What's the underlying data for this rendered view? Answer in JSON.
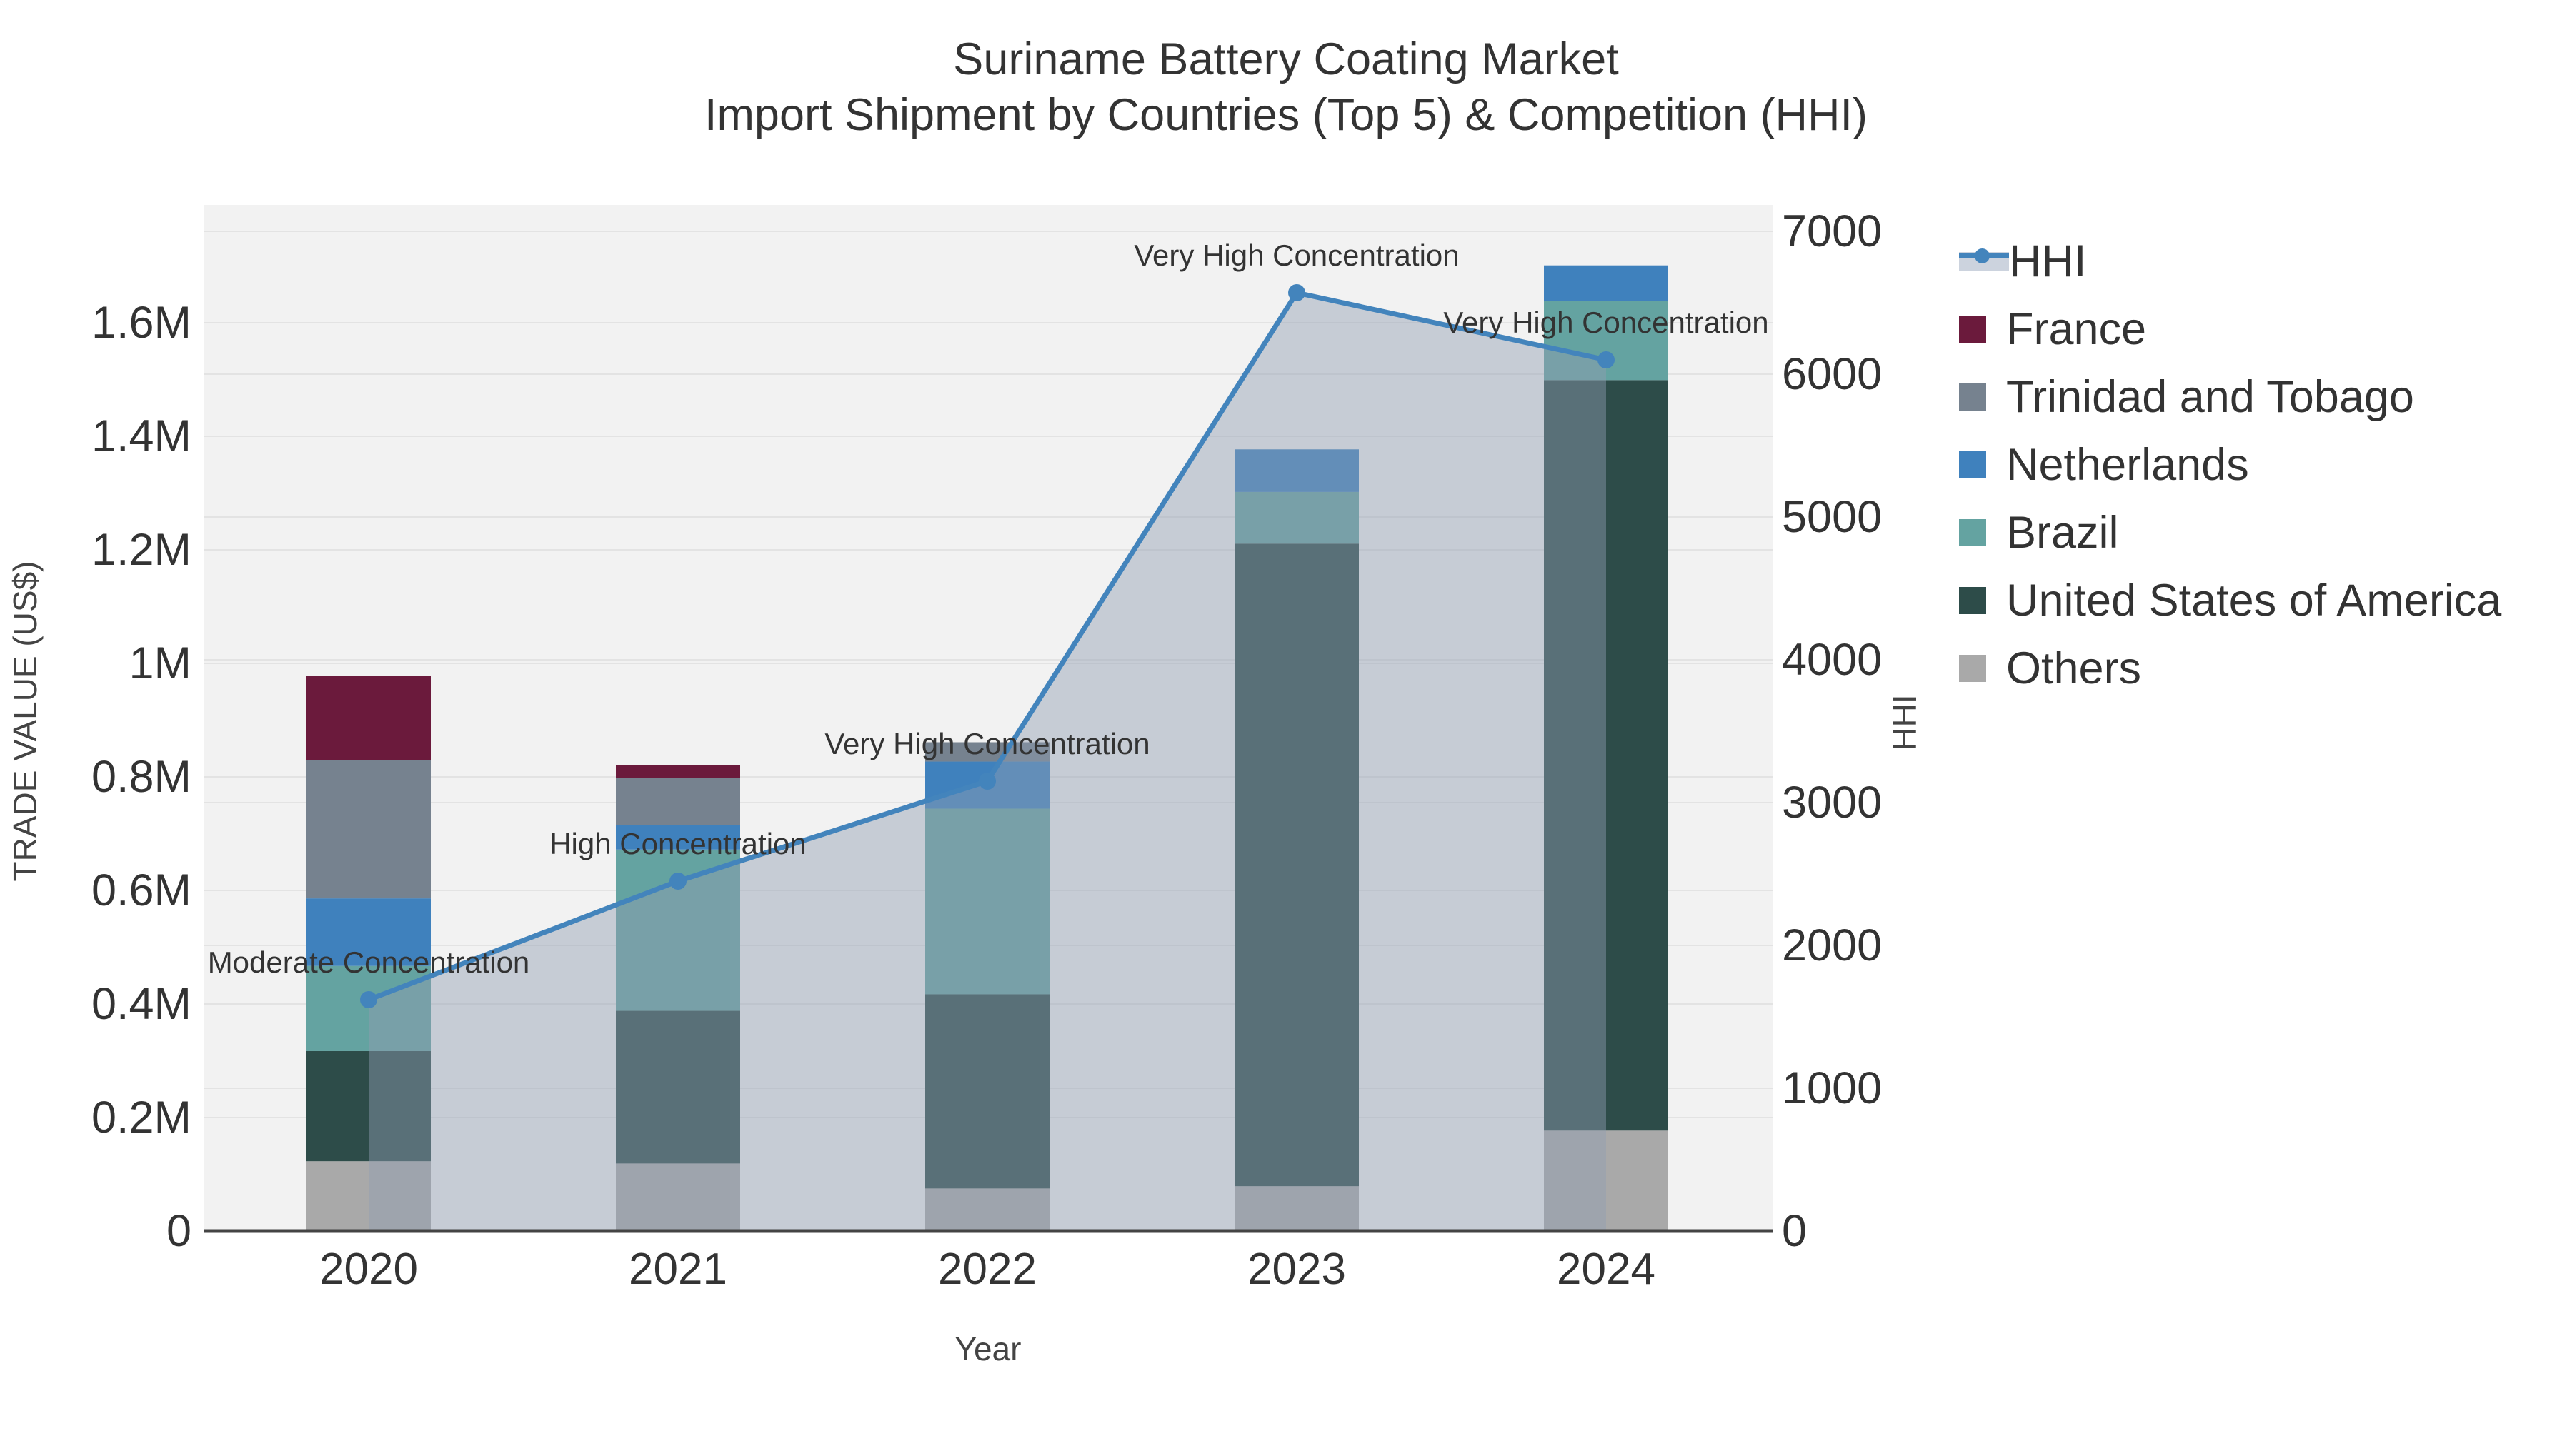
{
  "chart_data": {
    "type": "bar",
    "stacked": true,
    "title": "Suriname Battery Coating Market",
    "subtitle": "Import Shipment by Countries (Top 5) & Competition (HHI)",
    "categories": [
      "2020",
      "2021",
      "2022",
      "2023",
      "2024"
    ],
    "series": [
      {
        "name": "Others",
        "color": "#a9a9a9",
        "values": [
          123000,
          119000,
          75000,
          79000,
          177000
        ]
      },
      {
        "name": "United States of America",
        "color": "#2d4c49",
        "values": [
          194000,
          269000,
          342000,
          1132000,
          1322000
        ]
      },
      {
        "name": "Brazil",
        "color": "#64a3a1",
        "values": [
          150000,
          284000,
          327000,
          91000,
          140000
        ]
      },
      {
        "name": "Netherlands",
        "color": "#3f81bd",
        "values": [
          119000,
          43000,
          83000,
          75000,
          62000
        ]
      },
      {
        "name": "Trinidad and Tobago",
        "color": "#76828f",
        "values": [
          244000,
          83000,
          34000,
          0,
          0
        ]
      },
      {
        "name": "France",
        "color": "#6b1a3c",
        "values": [
          148000,
          23000,
          0,
          0,
          0
        ]
      }
    ],
    "line_series": {
      "name": "HHI",
      "axis": "right",
      "color": "#4384bc",
      "fill_color": "rgba(145,157,178,0.45)",
      "values": [
        1620,
        2450,
        3150,
        6570,
        6100
      ]
    },
    "annotations": [
      {
        "category": "2020",
        "text": "Moderate Concentration"
      },
      {
        "category": "2021",
        "text": "High Concentration"
      },
      {
        "category": "2022",
        "text": "Very High Concentration"
      },
      {
        "category": "2023",
        "text": "Very High Concentration"
      },
      {
        "category": "2024",
        "text": "Very High Concentration"
      }
    ],
    "x_axis": {
      "title": "Year",
      "tick_labels": [
        "2020",
        "2021",
        "2022",
        "2023",
        "2024"
      ]
    },
    "y_axis_left": {
      "title": "TRADE VALUE (US$)",
      "tick_values": [
        0,
        200000,
        400000,
        600000,
        800000,
        1000000,
        1200000,
        1400000,
        1600000
      ],
      "tick_labels": [
        "0",
        "0.2M",
        "0.4M",
        "0.6M",
        "0.8M",
        "1M",
        "1.2M",
        "1.4M",
        "1.6M"
      ],
      "range": [
        0,
        1807500
      ]
    },
    "y_axis_right": {
      "title": "HHI",
      "tick_values": [
        0,
        1000,
        2000,
        3000,
        4000,
        5000,
        6000,
        7000
      ],
      "tick_labels": [
        "0",
        "1000",
        "2000",
        "3000",
        "4000",
        "5000",
        "6000",
        "7000"
      ],
      "range": [
        0,
        7185
      ]
    },
    "legend_order": [
      "HHI",
      "France",
      "Trinidad and Tobago",
      "Netherlands",
      "Brazil",
      "United States of America",
      "Others"
    ],
    "grid": true,
    "legend_position": "right"
  },
  "colors": {
    "plot_bg": "#f2f2f2",
    "grid": "#e3e3e3",
    "axis_line": "#444444",
    "text": "#333333"
  }
}
